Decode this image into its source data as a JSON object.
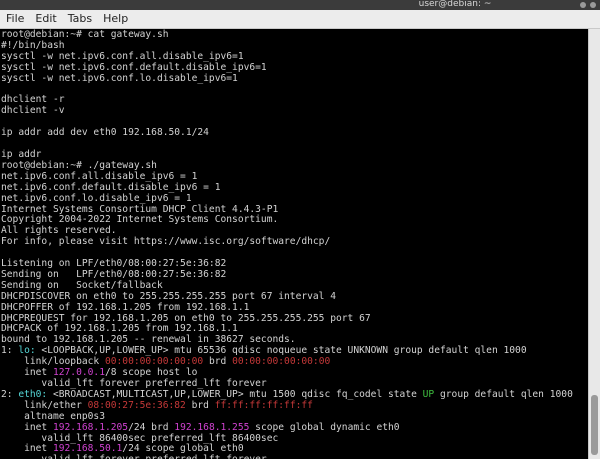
{
  "window": {
    "title": "user@debian: ~"
  },
  "menubar": {
    "items": [
      "File",
      "Edit",
      "Tabs",
      "Help"
    ]
  },
  "colors": {
    "terminal_bg": "#000000",
    "terminal_fg": "#d3d3d3",
    "interface_name": "#55d6d6",
    "address": "#d042d0",
    "link_address_down": "#c43838",
    "state_up": "#3fbf3f"
  },
  "terminal": {
    "lines": [
      [
        {
          "t": "root@debian:~# cat gateway.sh"
        }
      ],
      [
        {
          "t": "#!/bin/bash"
        }
      ],
      [
        {
          "t": "sysctl -w net.ipv6.conf.all.disable_ipv6=1"
        }
      ],
      [
        {
          "t": "sysctl -w net.ipv6.conf.default.disable_ipv6=1"
        }
      ],
      [
        {
          "t": "sysctl -w net.ipv6.conf.lo.disable_ipv6=1"
        }
      ],
      [
        {
          "t": ""
        }
      ],
      [
        {
          "t": "dhclient -r"
        }
      ],
      [
        {
          "t": "dhclient -v"
        }
      ],
      [
        {
          "t": ""
        }
      ],
      [
        {
          "t": "ip addr add dev eth0 192.168.50.1/24"
        }
      ],
      [
        {
          "t": ""
        }
      ],
      [
        {
          "t": "ip addr"
        }
      ],
      [
        {
          "t": "root@debian:~# ./gateway.sh"
        }
      ],
      [
        {
          "t": "net.ipv6.conf.all.disable_ipv6 = 1"
        }
      ],
      [
        {
          "t": "net.ipv6.conf.default.disable_ipv6 = 1"
        }
      ],
      [
        {
          "t": "net.ipv6.conf.lo.disable_ipv6 = 1"
        }
      ],
      [
        {
          "t": "Internet Systems Consortium DHCP Client 4.4.3-P1"
        }
      ],
      [
        {
          "t": "Copyright 2004-2022 Internet Systems Consortium."
        }
      ],
      [
        {
          "t": "All rights reserved."
        }
      ],
      [
        {
          "t": "For info, please visit https://www.isc.org/software/dhcp/"
        }
      ],
      [
        {
          "t": ""
        }
      ],
      [
        {
          "t": "Listening on LPF/eth0/08:00:27:5e:36:82"
        }
      ],
      [
        {
          "t": "Sending on   LPF/eth0/08:00:27:5e:36:82"
        }
      ],
      [
        {
          "t": "Sending on   Socket/fallback"
        }
      ],
      [
        {
          "t": "DHCPDISCOVER on eth0 to 255.255.255.255 port 67 interval 4"
        }
      ],
      [
        {
          "t": "DHCPOFFER of 192.168.1.205 from 192.168.1.1"
        }
      ],
      [
        {
          "t": "DHCPREQUEST for 192.168.1.205 on eth0 to 255.255.255.255 port 67"
        }
      ],
      [
        {
          "t": "DHCPACK of 192.168.1.205 from 192.168.1.1"
        }
      ],
      [
        {
          "t": "bound to 192.168.1.205 -- renewal in 38627 seconds."
        }
      ],
      [
        {
          "t": "1: "
        },
        {
          "t": "lo:",
          "c": "c-cyan"
        },
        {
          "t": " <LOOPBACK,UP,LOWER_UP> mtu 65536 qdisc noqueue state UNKNOWN group default qlen 1000"
        }
      ],
      [
        {
          "t": "    link/loopback "
        },
        {
          "t": "00:00:00:00:00:00",
          "c": "c-red"
        },
        {
          "t": " brd "
        },
        {
          "t": "00:00:00:00:00:00",
          "c": "c-red"
        }
      ],
      [
        {
          "t": "    inet "
        },
        {
          "t": "127.0.0.1",
          "c": "c-magenta"
        },
        {
          "t": "/8 scope host lo"
        }
      ],
      [
        {
          "t": "       valid_lft forever preferred_lft forever"
        }
      ],
      [
        {
          "t": "2: "
        },
        {
          "t": "eth0:",
          "c": "c-cyan"
        },
        {
          "t": " <BROADCAST,MULTICAST,UP,LOWER_UP> mtu 1500 qdisc fq_codel state "
        },
        {
          "t": "UP",
          "c": "c-green"
        },
        {
          "t": " group default qlen 1000"
        }
      ],
      [
        {
          "t": "    link/ether "
        },
        {
          "t": "08:00:27:5e:36:82",
          "c": "c-red"
        },
        {
          "t": " brd "
        },
        {
          "t": "ff:ff:ff:ff:ff:ff",
          "c": "c-red"
        }
      ],
      [
        {
          "t": "    altname enp0s3"
        }
      ],
      [
        {
          "t": "    inet "
        },
        {
          "t": "192.168.1.205",
          "c": "c-magenta"
        },
        {
          "t": "/24 brd "
        },
        {
          "t": "192.168.1.255",
          "c": "c-magenta"
        },
        {
          "t": " scope global dynamic eth0"
        }
      ],
      [
        {
          "t": "       valid_lft 86400sec preferred_lft 86400sec"
        }
      ],
      [
        {
          "t": "    inet "
        },
        {
          "t": "192.168.50.1",
          "c": "c-magenta"
        },
        {
          "t": "/24 scope global eth0"
        }
      ],
      [
        {
          "t": "       valid_lft forever preferred_lft forever"
        }
      ]
    ]
  }
}
